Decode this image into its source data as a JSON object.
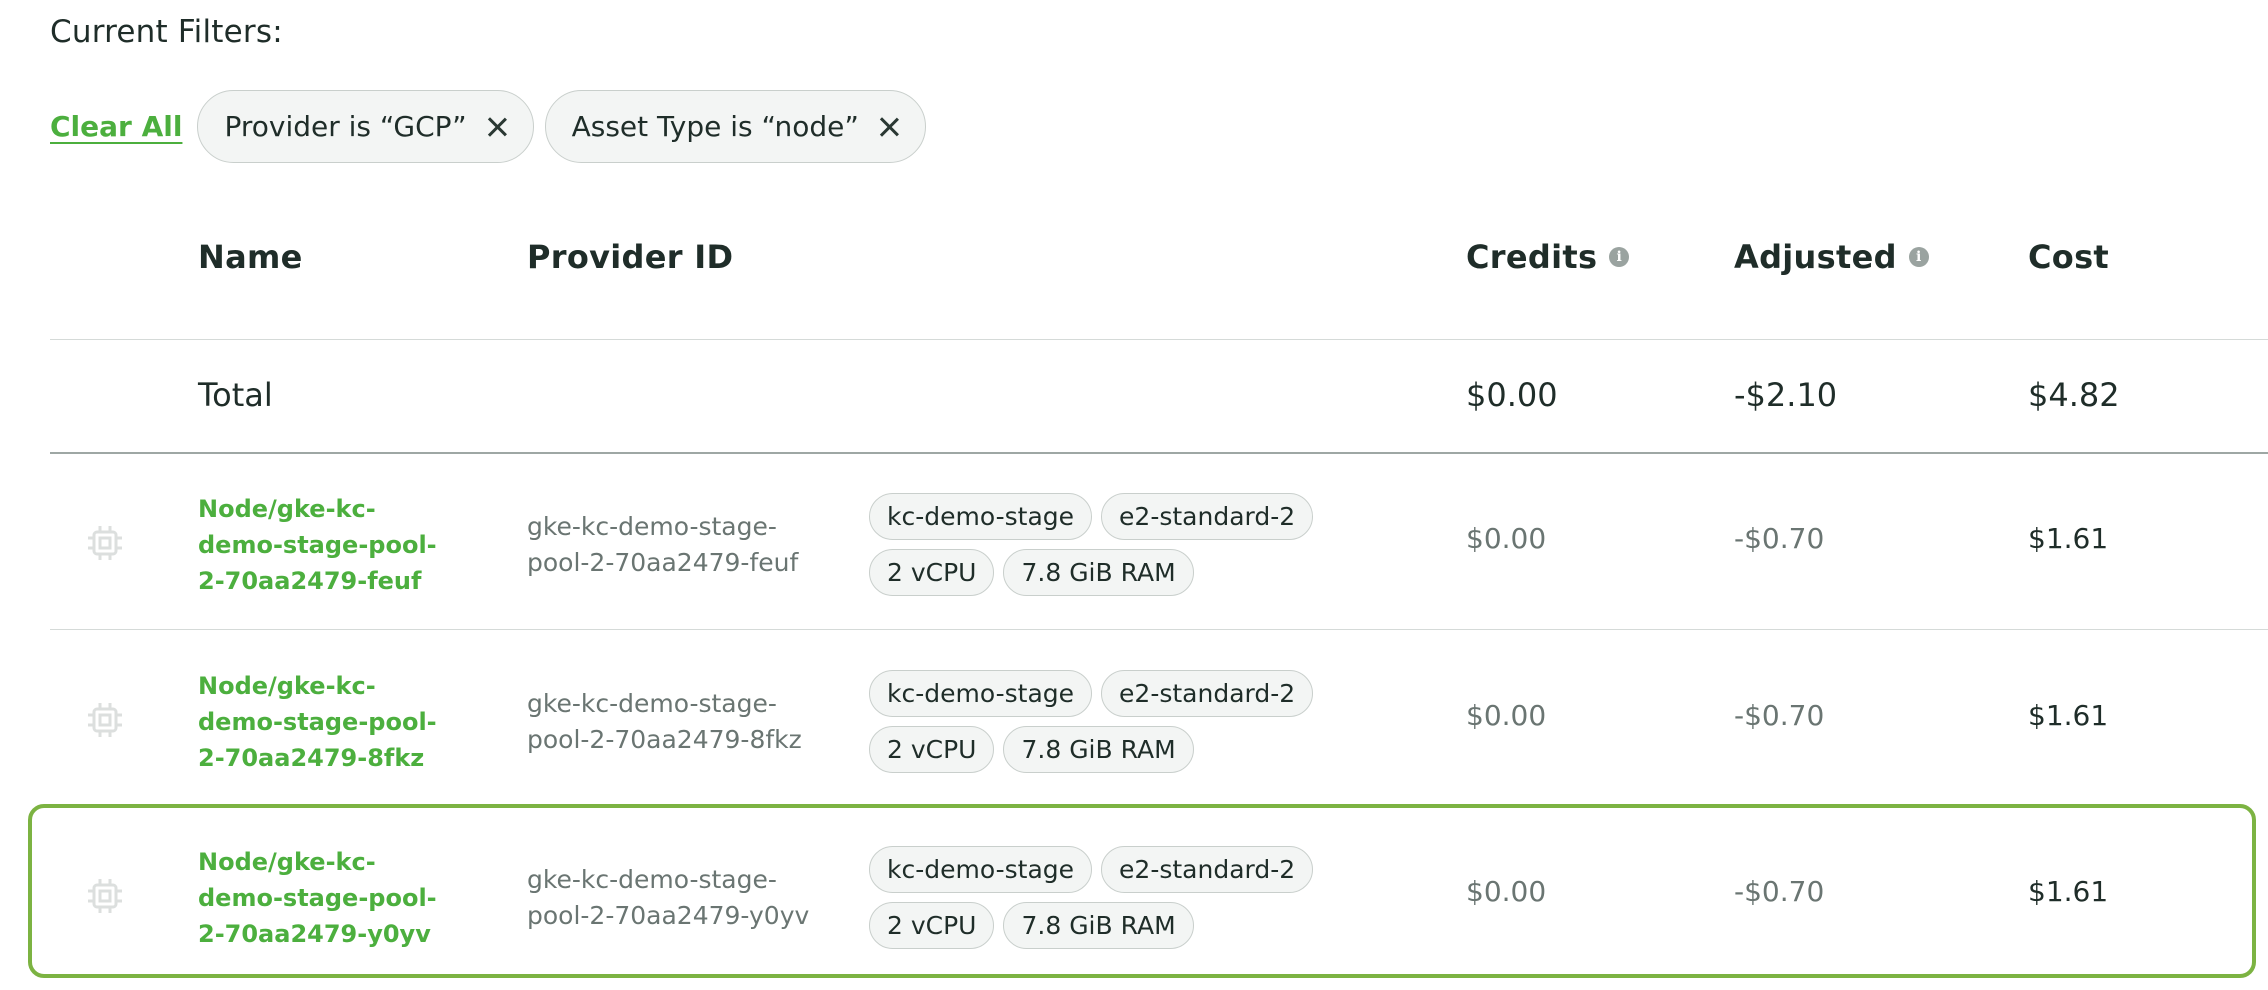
{
  "filters": {
    "title": "Current Filters:",
    "clear_all": "Clear All",
    "chips": [
      "Provider is “GCP”",
      "Asset Type is “node”"
    ]
  },
  "table": {
    "headers": {
      "name": "Name",
      "provider_id": "Provider ID",
      "credits": "Credits",
      "adjusted": "Adjusted",
      "cost": "Cost"
    },
    "total": {
      "label": "Total",
      "credits": "$0.00",
      "adjusted": "-$2.10",
      "cost": "$4.82"
    },
    "rows": [
      {
        "name": "Node/gke-kc-demo-stage-pool-2-70aa2479-feuf",
        "provider_id": "gke-kc-demo-stage-pool-2-70aa2479-feuf",
        "tags": [
          "kc-demo-stage",
          "e2-standard-2",
          "2 vCPU",
          "7.8 GiB RAM"
        ],
        "credits": "$0.00",
        "adjusted": "-$0.70",
        "cost": "$1.61",
        "selected": false
      },
      {
        "name": "Node/gke-kc-demo-stage-pool-2-70aa2479-8fkz",
        "provider_id": "gke-kc-demo-stage-pool-2-70aa2479-8fkz",
        "tags": [
          "kc-demo-stage",
          "e2-standard-2",
          "2 vCPU",
          "7.8 GiB RAM"
        ],
        "credits": "$0.00",
        "adjusted": "-$0.70",
        "cost": "$1.61",
        "selected": false
      },
      {
        "name": "Node/gke-kc-demo-stage-pool-2-70aa2479-y0yv",
        "provider_id": "gke-kc-demo-stage-pool-2-70aa2479-y0yv",
        "tags": [
          "kc-demo-stage",
          "e2-standard-2",
          "2 vCPU",
          "7.8 GiB RAM"
        ],
        "credits": "$0.00",
        "adjusted": "-$0.70",
        "cost": "$1.61",
        "selected": true
      }
    ]
  },
  "icons": {
    "row_icon": "cpu-icon",
    "info_icon": "info-icon",
    "chip_remove": "close-icon"
  },
  "colors": {
    "accent_green": "#4caf3e",
    "highlight_border": "#7cb342",
    "chip_bg": "#f3f5f4"
  }
}
